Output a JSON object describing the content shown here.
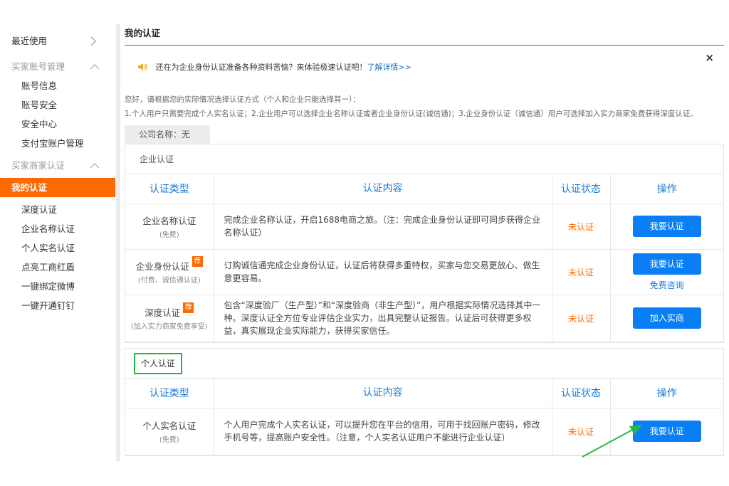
{
  "sidebar": {
    "recent": "最近使用",
    "group_account": "买家账号管理",
    "account_items": [
      "账号信息",
      "账号安全",
      "安全中心",
      "支付宝账户管理"
    ],
    "group_cert": "买家商家认证",
    "cert_items": [
      "我的认证",
      "深度认证",
      "企业名称认证",
      "个人实名认证",
      "点亮工商红盾",
      "一键绑定微博",
      "一键开通钉钉"
    ]
  },
  "page_title": "我的认证",
  "notice": {
    "text": "还在为企业身份认证准备各种资料苦恼？来体验极速认证吧！",
    "link": "了解详情>>",
    "close": "×"
  },
  "intro": {
    "line1": "您好，请根据您的实际情况选择认证方式（个人和企业只能选择其一）：",
    "line2": "1.个人用户只需要完成个人实名认证；2.企业用户可以选择企业名称认证或者企业身份认证(诚信通)；3.企业身份认证（诚信通）用户可选择加入实力商家免费获得深度认证。"
  },
  "company": "公司名称：无",
  "table_headers": [
    "认证类型",
    "认证内容",
    "认证状态",
    "操作"
  ],
  "enterprise": {
    "title": "企业认证",
    "rows": [
      {
        "name": "企业名称认证",
        "tag": "",
        "sub": "(免费)",
        "content": "完成企业名称认证，开启1688电商之旅。（注：完成企业身份认证即可同步获得企业名称认证）",
        "status": "未认证",
        "button": "我要认证",
        "link": ""
      },
      {
        "name": "企业身份认证",
        "tag": "荐",
        "sub": "(付费、诚信通认证)",
        "content": "订购诚信通完成企业身份认证，认证后将获得多重特权，买家与您交易更放心、做生意更容易。",
        "status": "未认证",
        "button": "我要认证",
        "link": "免费咨询"
      },
      {
        "name": "深度认证",
        "tag": "荐",
        "sub": "(加入实力商家免费享受)",
        "content": "包含“深度验厂（生产型）”和“深度验商（非生产型）”，用户根据实际情况选择其中一种。深度认证全方位专业评估企业实力，出具完整认证报告。认证后可获得更多权益，真实展现企业实际能力，获得买家信任。",
        "status": "未认证",
        "button": "加入实商",
        "link": ""
      }
    ]
  },
  "personal": {
    "title": "个人认证",
    "rows": [
      {
        "name": "个人实名认证",
        "tag": "",
        "sub": "(免费)",
        "content": "个人用户完成个人实名认证，可以提升您在平台的信用，可用于找回账户密码，修改手机号等，提高账户安全性。（注意，个人实名认证用户不能进行企业认证）",
        "status": "未认证",
        "button": "我要认证",
        "link": ""
      }
    ]
  },
  "colors": {
    "accent_orange": "#ff6a00",
    "primary_blue": "#0a7ff5",
    "highlight_green": "#26b74a"
  }
}
